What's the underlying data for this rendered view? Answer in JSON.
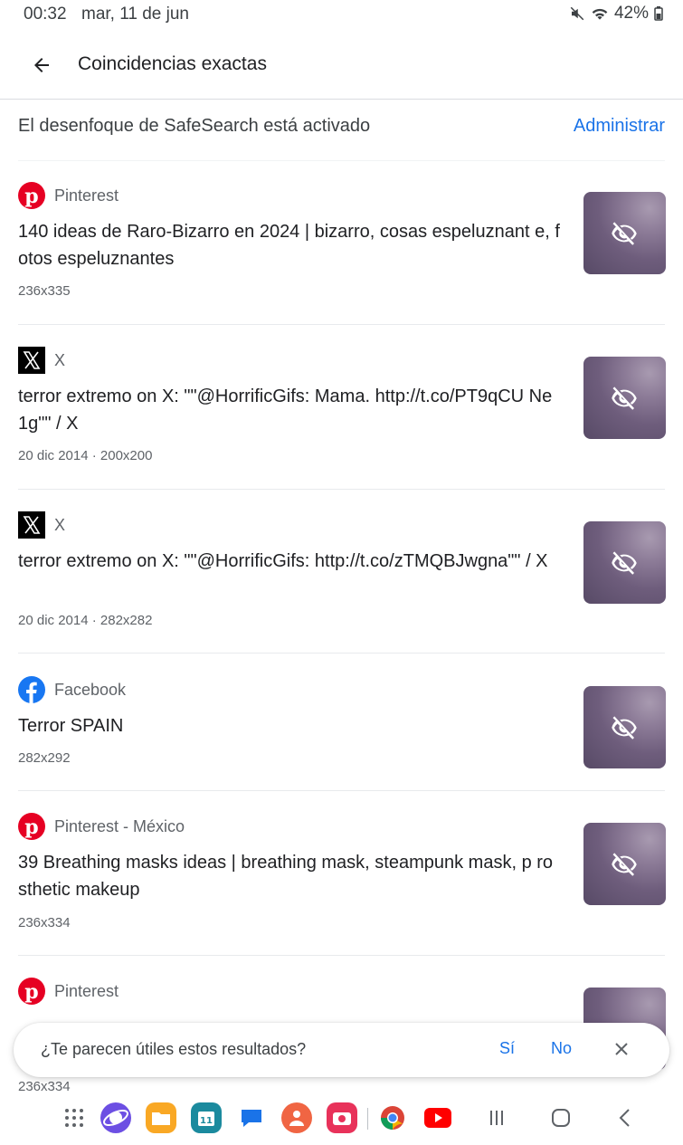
{
  "status": {
    "time": "00:32",
    "date": "mar, 11 de jun",
    "battery": "42%"
  },
  "header": {
    "title": "Coincidencias exactas"
  },
  "safesearch": {
    "text": "El desenfoque de SafeSearch está activado",
    "action": "Administrar"
  },
  "results": [
    {
      "source": "Pinterest",
      "icon": "pinterest-icon",
      "title": "140 ideas de Raro-Bizarro en 2024 | bizarro, cosas espeluznant e, fotos espeluznantes",
      "meta": "236x335"
    },
    {
      "source": "X",
      "icon": "x-icon",
      "title": "terror extremo on X: \"\"@HorrificGifs: Mama. http://t.co/PT9qCU Ne1g\"\" / X",
      "meta": "20 dic 2014 · 200x200"
    },
    {
      "source": "X",
      "icon": "x-icon",
      "title": "terror extremo on X: \"\"@HorrificGifs: http://t.co/zTMQBJwgna\"\" / X",
      "meta": "20 dic 2014 · 282x282"
    },
    {
      "source": "Facebook",
      "icon": "facebook-icon",
      "title": "Terror SPAIN",
      "meta": "282x292"
    },
    {
      "source": "Pinterest - México",
      "icon": "pinterest-icon",
      "title": "39 Breathing masks ideas | breathing mask, steampunk mask, p rosthetic makeup",
      "meta": "236x334"
    },
    {
      "source": "Pinterest",
      "icon": "pinterest-icon",
      "title": "",
      "meta": "236x334"
    }
  ],
  "feedback": {
    "question": "¿Te parecen útiles estos resultados?",
    "yes": "Sí",
    "no": "No"
  },
  "colors": {
    "accent": "#1a73e8",
    "pinterest": "#e60023",
    "facebook": "#1877f2"
  }
}
